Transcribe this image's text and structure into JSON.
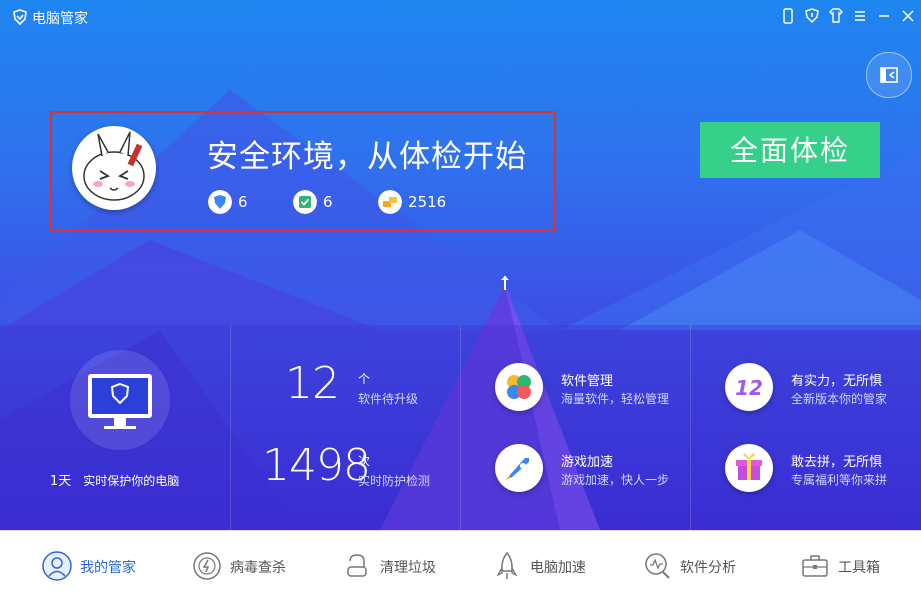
{
  "window": {
    "title": "电脑管家"
  },
  "hero": {
    "headline": "安全环境，从体检开始",
    "stats": [
      {
        "icon": "shield-icon",
        "value": "6"
      },
      {
        "icon": "green-check-icon",
        "value": "6"
      },
      {
        "icon": "gold-coins-icon",
        "value": "2516"
      }
    ],
    "scan_button": "全面体检"
  },
  "protection": {
    "days": "1天",
    "label": "实时保护你的电脑"
  },
  "counters": [
    {
      "value": "12",
      "unit": "个",
      "label": "软件待升级"
    },
    {
      "value": "1498",
      "unit": "次",
      "label": "实时防护检测"
    }
  ],
  "features": [
    {
      "title": "软件管理",
      "subtitle": "海量软件，轻松管理",
      "icon": "pinwheel-icon"
    },
    {
      "title": "有实力，无所惧",
      "subtitle": "全新版本你的管家",
      "icon": "version-12-icon"
    },
    {
      "title": "游戏加速",
      "subtitle": "游戏加速，快人一步",
      "icon": "game-rocket-icon"
    },
    {
      "title": "敢去拼，无所惧",
      "subtitle": "专属福利等你来拼",
      "icon": "gift-icon"
    }
  ],
  "nav": [
    {
      "label": "我的管家",
      "icon": "butler-icon",
      "active": true
    },
    {
      "label": "病毒查杀",
      "icon": "virus-scan-icon",
      "active": false
    },
    {
      "label": "清理垃圾",
      "icon": "vacuum-icon",
      "active": false
    },
    {
      "label": "电脑加速",
      "icon": "rocket-icon",
      "active": false
    },
    {
      "label": "软件分析",
      "icon": "analysis-icon",
      "active": false
    },
    {
      "label": "工具箱",
      "icon": "toolbox-icon",
      "active": false
    }
  ],
  "colors": {
    "accent": "#37d08a",
    "brand_blue": "#2a66d6",
    "highlight_border": "#e2302a"
  }
}
